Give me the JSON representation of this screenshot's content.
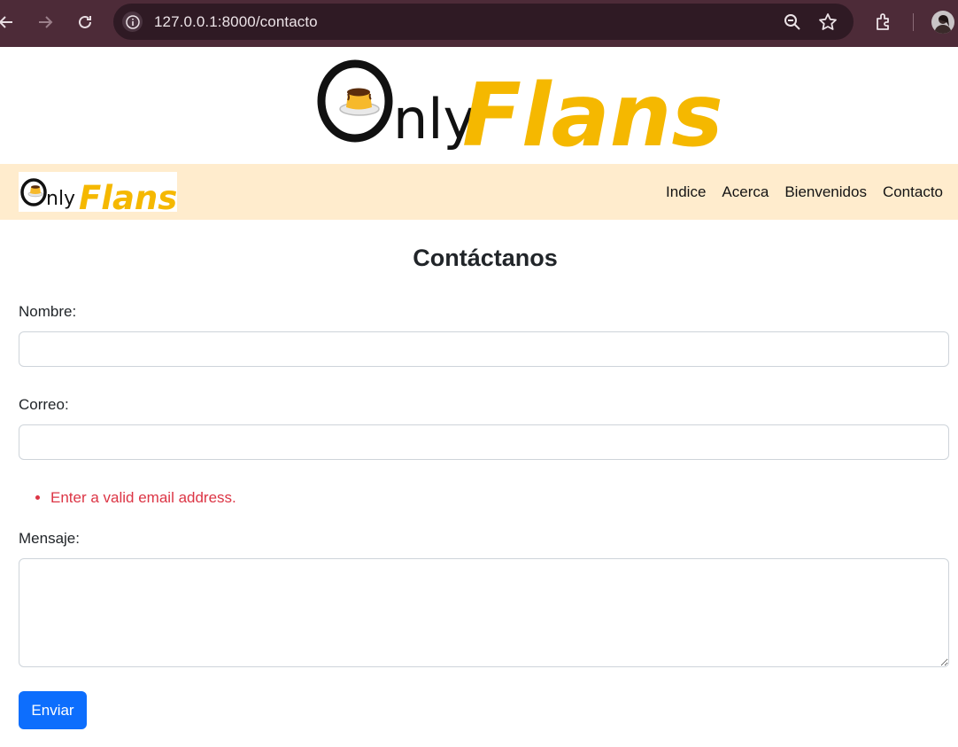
{
  "browser": {
    "url": "127.0.0.1:8000/contacto"
  },
  "brand": {
    "wordmark_left": "Only",
    "wordmark_right": "Flans",
    "colors": {
      "dark": "#111111",
      "gold": "#f5b800"
    }
  },
  "navbar": {
    "links": [
      "Indice",
      "Acerca",
      "Bienvenidos",
      "Contacto"
    ]
  },
  "form": {
    "title": "Contáctanos",
    "name_label": "Nombre:",
    "name_value": "",
    "email_label": "Correo:",
    "email_value": "",
    "email_error": "Enter a valid email address.",
    "message_label": "Mensaje:",
    "message_value": "",
    "submit_label": "Enviar"
  },
  "colors": {
    "chrome_bg": "#4d2b38",
    "navbar_bg": "#ffeccd",
    "error": "#dc3545",
    "primary": "#0d6efd"
  }
}
